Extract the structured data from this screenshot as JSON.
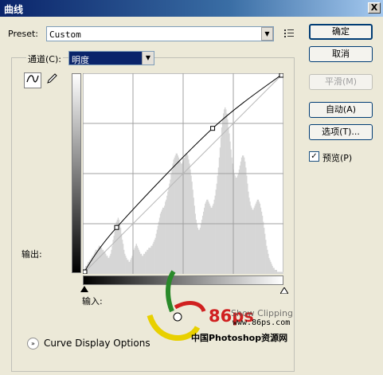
{
  "window": {
    "title": "曲线",
    "close_label": "X"
  },
  "preset": {
    "label": "Preset:",
    "value": "Custom"
  },
  "channel": {
    "label": "通道(C):",
    "value": "明度"
  },
  "buttons": {
    "ok": "确定",
    "cancel": "取消",
    "smooth": "平滑(M)",
    "auto": "自动(A)",
    "options": "选项(T)..."
  },
  "preview": {
    "label": "预览(P)",
    "checked": true,
    "check_mark": "✓"
  },
  "axes": {
    "output_label": "输出:",
    "input_label": "输入:"
  },
  "footer": {
    "expander_label": "Curve Display Options",
    "expander_glyph": "»"
  },
  "watermark": {
    "brand": "86ps",
    "url": "www.86ps.com",
    "site_name": "中国Photoshop资源网",
    "extra": "Show Clipping"
  },
  "chart_data": {
    "type": "line",
    "xlim": [
      0,
      255
    ],
    "ylim": [
      0,
      255
    ],
    "grid": "4x4",
    "series": [
      {
        "values": [
          [
            0,
            0
          ],
          [
            43,
            59
          ],
          [
            165,
            185
          ],
          [
            255,
            255
          ]
        ]
      }
    ],
    "baseline": [
      [
        0,
        0
      ],
      [
        255,
        255
      ]
    ],
    "histogram": [
      2,
      2,
      3,
      4,
      4,
      5,
      6,
      6,
      7,
      7,
      8,
      9,
      9,
      10,
      11,
      12,
      12,
      12,
      13,
      14,
      14,
      13,
      13,
      12,
      12,
      11,
      11,
      10,
      9,
      9,
      8,
      8,
      9,
      10,
      12,
      14,
      17,
      19,
      22,
      24,
      26,
      27,
      28,
      27,
      25,
      23,
      20,
      17,
      15,
      12,
      10,
      9,
      8,
      7,
      7,
      6,
      6,
      7,
      8,
      9,
      10,
      12,
      13,
      14,
      15,
      14,
      13,
      12,
      11,
      10,
      10,
      9,
      9,
      10,
      10,
      11,
      11,
      12,
      12,
      13,
      13,
      13,
      14,
      14,
      15,
      16,
      17,
      18,
      20,
      22,
      24,
      26,
      28,
      30,
      31,
      32,
      33,
      33,
      34,
      36,
      37,
      39,
      41,
      43,
      45,
      47,
      50,
      52,
      55,
      57,
      58,
      59,
      60,
      60,
      59,
      58,
      57,
      56,
      55,
      55,
      56,
      57,
      58,
      59,
      60,
      60,
      59,
      57,
      55,
      52,
      49,
      46,
      42,
      38,
      34,
      30,
      27,
      25,
      23,
      22,
      22,
      23,
      25,
      27,
      29,
      31,
      33,
      35,
      36,
      37,
      37,
      36,
      35,
      34,
      33,
      33,
      34,
      35,
      37,
      39,
      42,
      45,
      49,
      53,
      58,
      63,
      68,
      73,
      77,
      80,
      82,
      83,
      82,
      80,
      77,
      73,
      70,
      66,
      62,
      58,
      55,
      52,
      50,
      49,
      48,
      48,
      49,
      50,
      52,
      54,
      56,
      58,
      59,
      59,
      58,
      56,
      53,
      49,
      45,
      41,
      38,
      36,
      34,
      33,
      32,
      32,
      33,
      34,
      35,
      36,
      37,
      37,
      36,
      35,
      33,
      31,
      29,
      26,
      23,
      20,
      17,
      14,
      12,
      10,
      8,
      7,
      6,
      5,
      4,
      3,
      3,
      2,
      2,
      2,
      1,
      1,
      1,
      1,
      1,
      1,
      1,
      1
    ]
  }
}
